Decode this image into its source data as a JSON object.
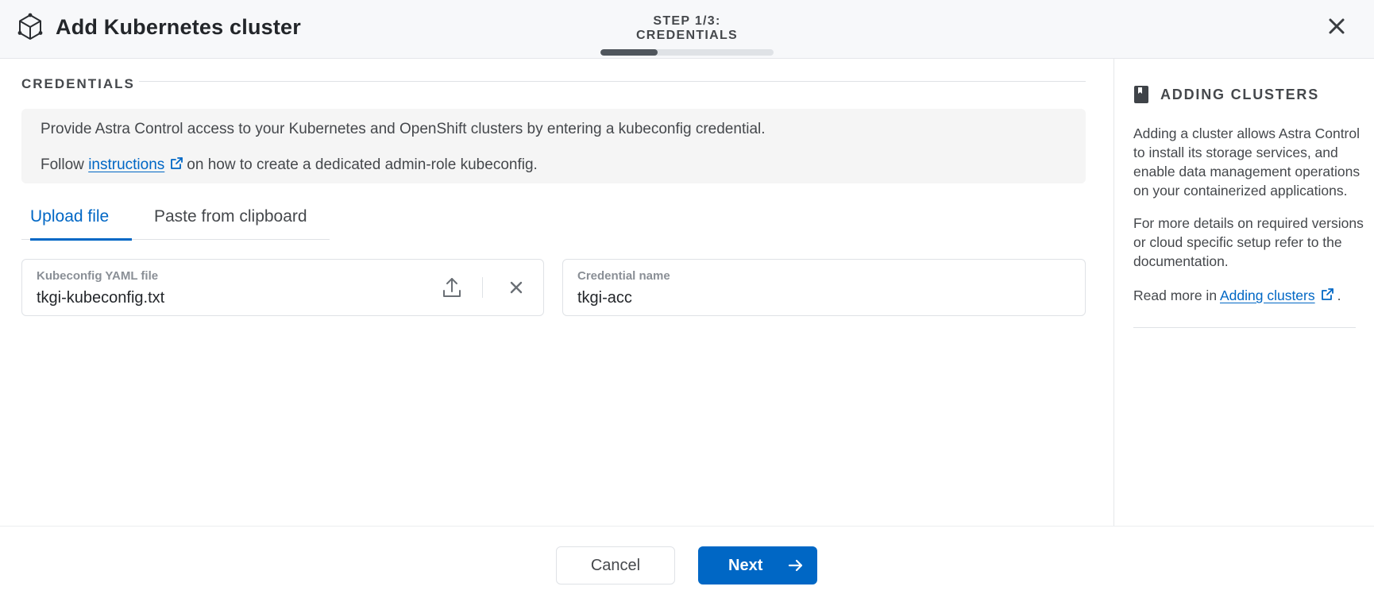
{
  "header": {
    "title": "Add Kubernetes cluster",
    "logo_icon": "cube-icon",
    "close_icon": "close-icon"
  },
  "stepper": {
    "label": "STEP 1/3: CREDENTIALS",
    "current_step": 1,
    "total_steps": 3,
    "progress_fraction": 0.33
  },
  "main": {
    "section_title": "CREDENTIALS",
    "info": {
      "line1": "Provide Astra Control access to your Kubernetes and OpenShift clusters by entering a kubeconfig credential.",
      "line2_prefix": "Follow",
      "line2_link": "instructions",
      "line2_suffix": "on how to create a dedicated admin-role kubeconfig."
    },
    "tabs": [
      {
        "label": "Upload file",
        "active": true
      },
      {
        "label": "Paste from clipboard",
        "active": false
      }
    ],
    "kubeconfig_field": {
      "label": "Kubeconfig YAML file",
      "value": "tkgi-kubeconfig.txt"
    },
    "credential_field": {
      "label": "Credential name",
      "value": "tkgi-acc"
    }
  },
  "side_panel": {
    "title": "ADDING CLUSTERS",
    "icon": "book-icon",
    "para1": "Adding a cluster allows Astra Control to install its storage services, and enable data management operations on your containerized applications.",
    "para2": "For more details on required versions or cloud specific setup refer to the documentation.",
    "para3_prefix": "Read more in",
    "para3_link": "Adding clusters",
    "para3_suffix": "."
  },
  "footer": {
    "cancel_label": "Cancel",
    "next_label": "Next"
  },
  "colors": {
    "accent": "#0067c5",
    "progress": "#50565d",
    "text": "#45484c"
  }
}
